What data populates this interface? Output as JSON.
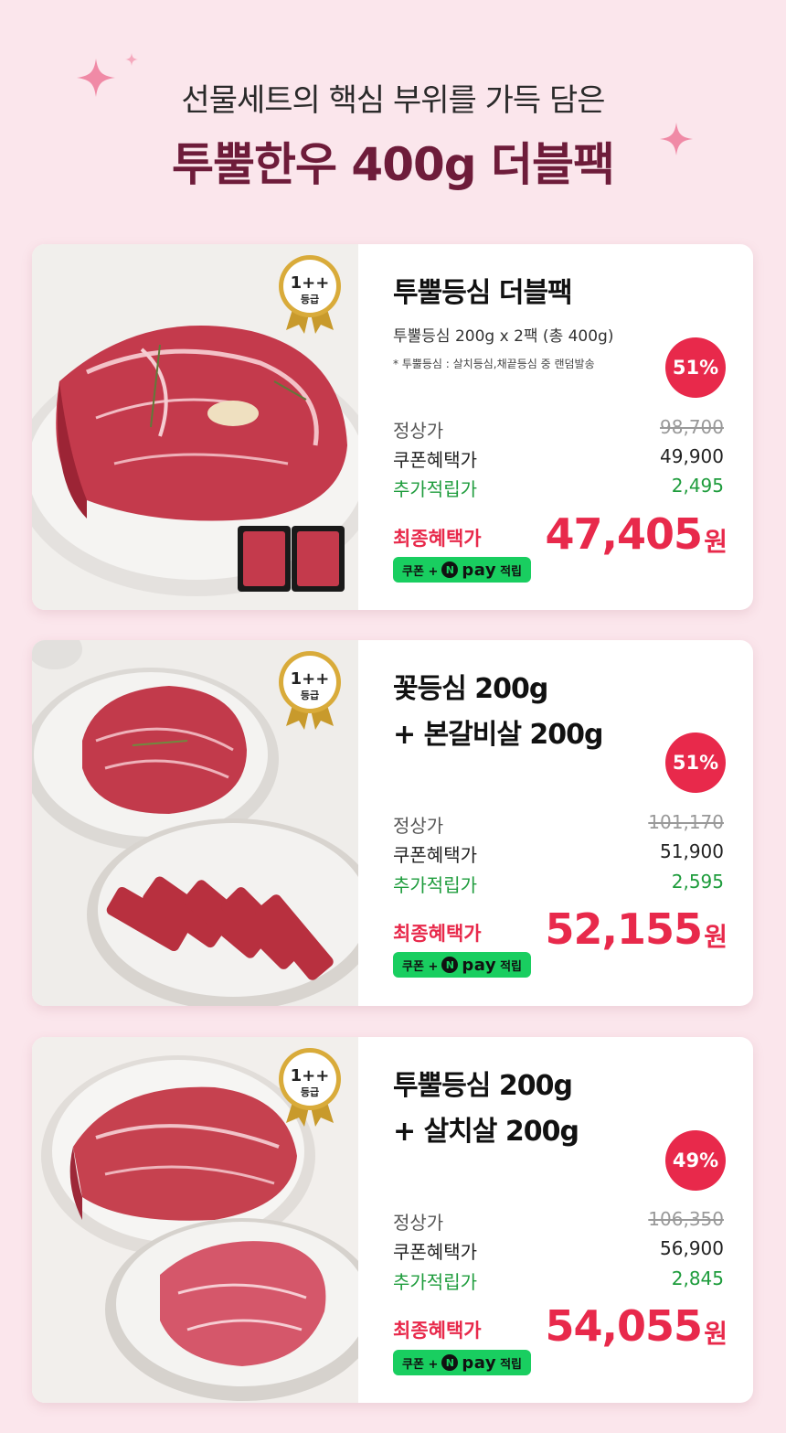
{
  "header": {
    "subtitle": "선물세트의 핵심 부위를 가득 담은",
    "title": "투뿔한우 400g 더블팩"
  },
  "colors": {
    "background": "#fbe6ec",
    "title": "#6e1c3a",
    "accent": "#e8294b",
    "point": "#1e9c3c",
    "npay": "#19ce60"
  },
  "products": [
    {
      "grade": "1++",
      "grade_sub": "등급",
      "name_line1": "투뿔등심 더블팩",
      "name_line2": "",
      "desc": "투뿔등심 200g x 2팩 (총 400g)",
      "note": "* 투뿔등심 : 살치등심,채끝등심 중 랜덤발송",
      "discount": "51%",
      "regular_label": "정상가",
      "regular_price": "98,700",
      "coupon_label": "쿠폰혜택가",
      "coupon_price": "49,900",
      "point_label": "추가적립가",
      "point_value": "2,495",
      "final_label": "최종혜택가",
      "final_price": "47,405",
      "final_unit": "원",
      "npay_prefix": "쿠폰 +",
      "npay_n": "N",
      "npay_pay": "pay",
      "npay_suffix": "적립"
    },
    {
      "grade": "1++",
      "grade_sub": "등급",
      "name_line1": "꽃등심 200g",
      "name_line2": "+ 본갈비살 200g",
      "discount": "51%",
      "regular_label": "정상가",
      "regular_price": "101,170",
      "coupon_label": "쿠폰혜택가",
      "coupon_price": "51,900",
      "point_label": "추가적립가",
      "point_value": "2,595",
      "final_label": "최종혜택가",
      "final_price": "52,155",
      "final_unit": "원",
      "npay_prefix": "쿠폰 +",
      "npay_n": "N",
      "npay_pay": "pay",
      "npay_suffix": "적립"
    },
    {
      "grade": "1++",
      "grade_sub": "등급",
      "name_line1": "투뿔등심 200g",
      "name_line2": "+ 살치살 200g",
      "discount": "49%",
      "regular_label": "정상가",
      "regular_price": "106,350",
      "coupon_label": "쿠폰혜택가",
      "coupon_price": "56,900",
      "point_label": "추가적립가",
      "point_value": "2,845",
      "final_label": "최종혜택가",
      "final_price": "54,055",
      "final_unit": "원",
      "npay_prefix": "쿠폰 +",
      "npay_n": "N",
      "npay_pay": "pay",
      "npay_suffix": "적립"
    }
  ]
}
